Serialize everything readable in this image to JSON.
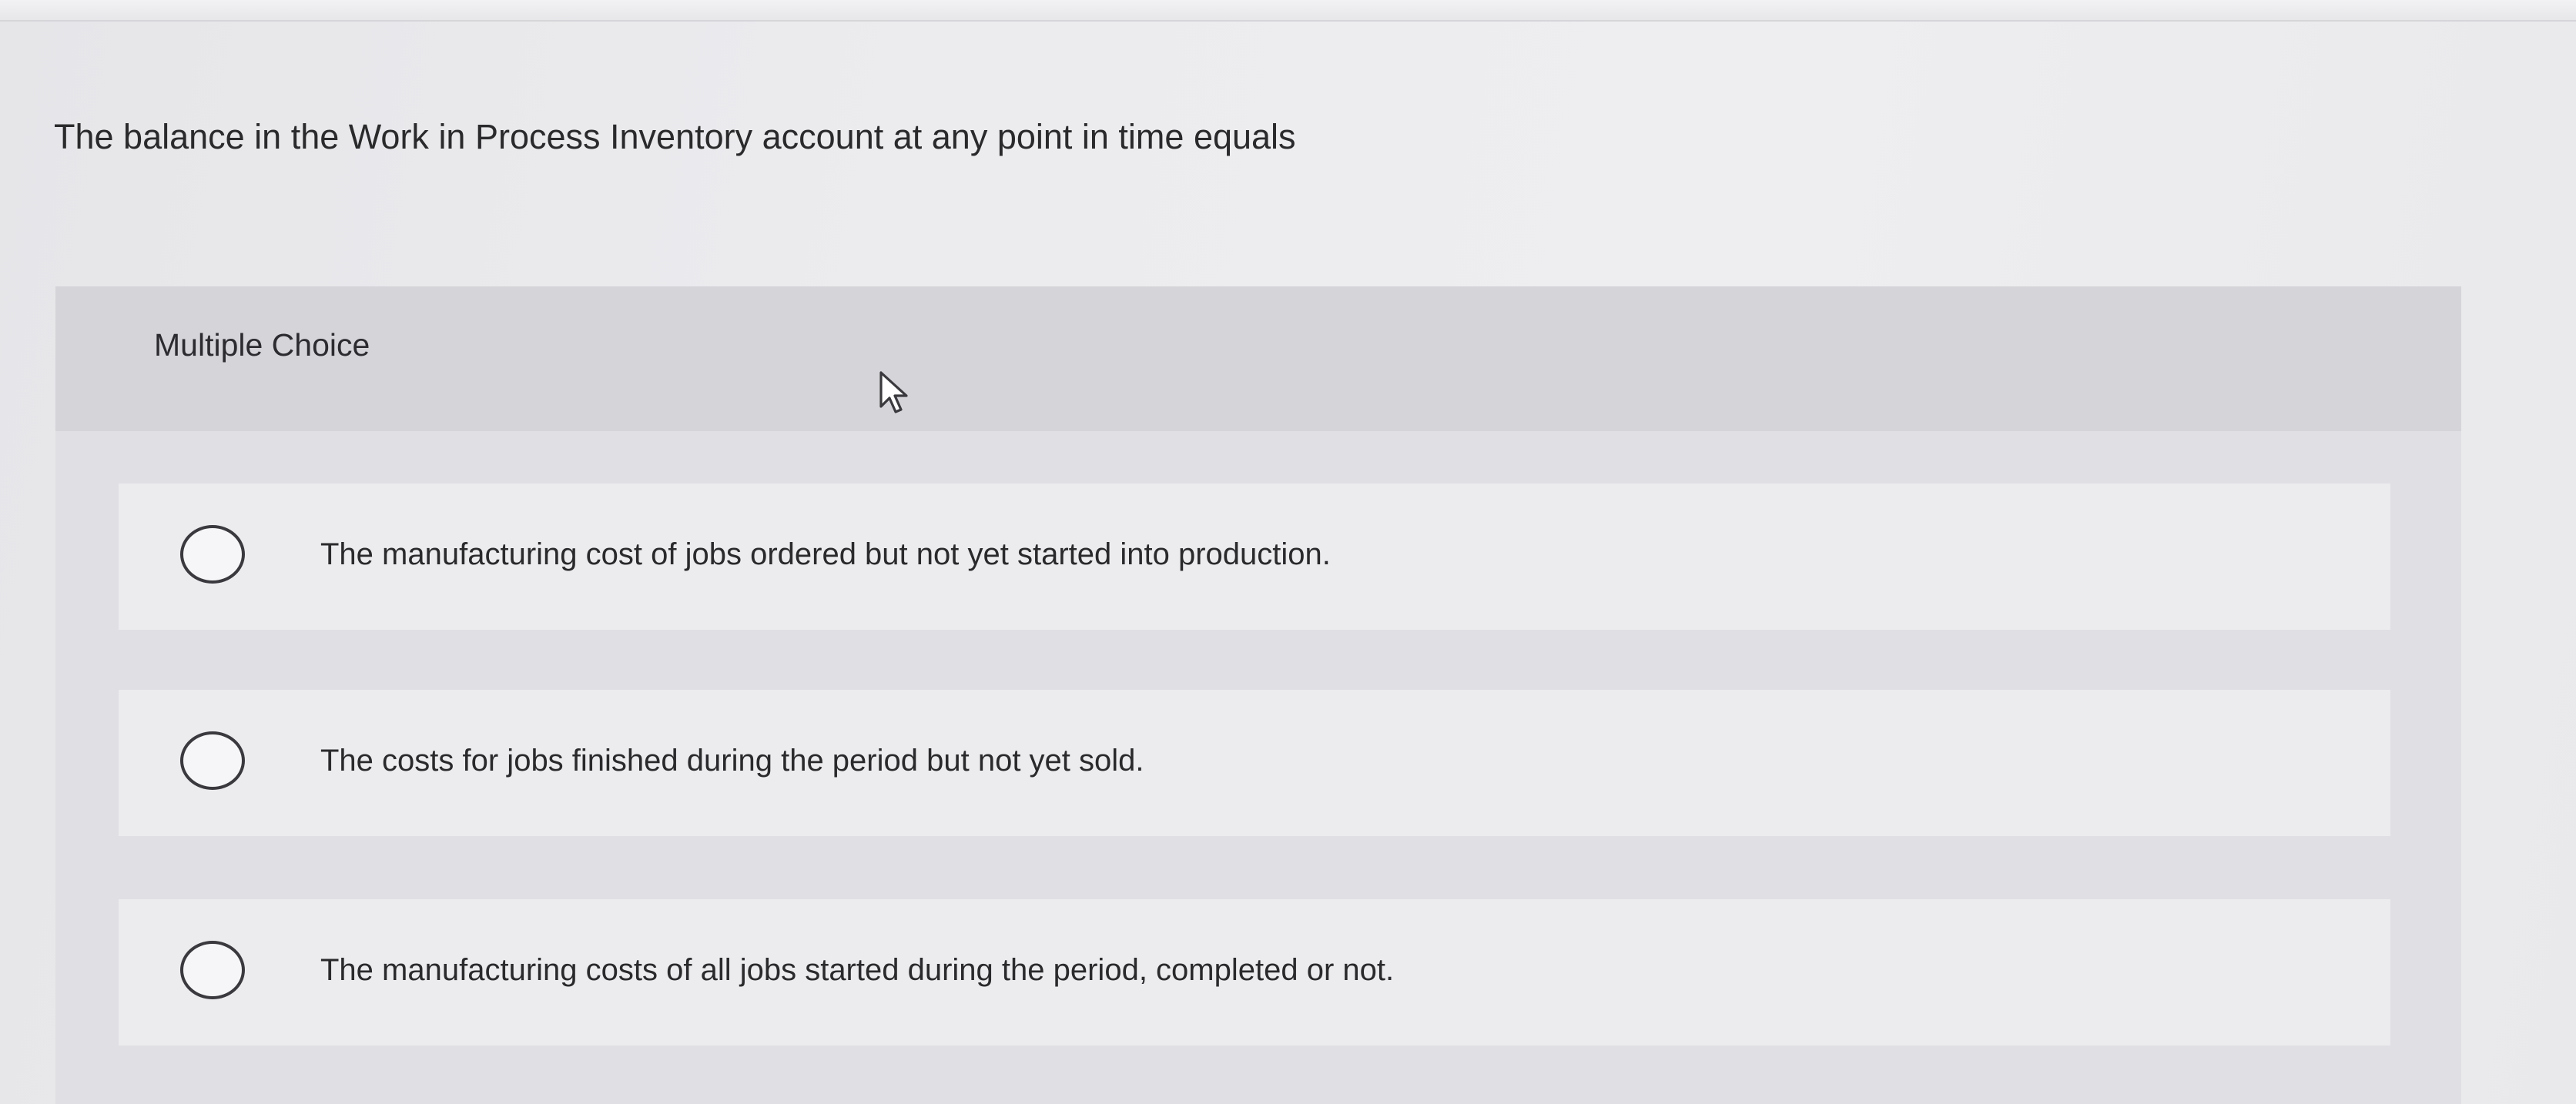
{
  "question": {
    "text": "The balance in the Work in Process Inventory account at any point in time equals"
  },
  "multiple_choice": {
    "title": "Multiple Choice",
    "options": [
      {
        "label": "The manufacturing cost of jobs ordered but not yet started into production.",
        "selected": false
      },
      {
        "label": "The costs for jobs finished during the period but not yet sold.",
        "selected": false
      },
      {
        "label": "The manufacturing costs of all jobs started during the period, completed or not.",
        "selected": false
      }
    ]
  },
  "cursor_icon": "mouse-pointer-arrow",
  "colors": {
    "page_background": "#ececef",
    "panel_background": "#e0e0e4",
    "panel_header": "#d5d5d9",
    "option_background": "#ececef",
    "radio_border": "#3a3a3e",
    "text": "#2a2a2d"
  }
}
